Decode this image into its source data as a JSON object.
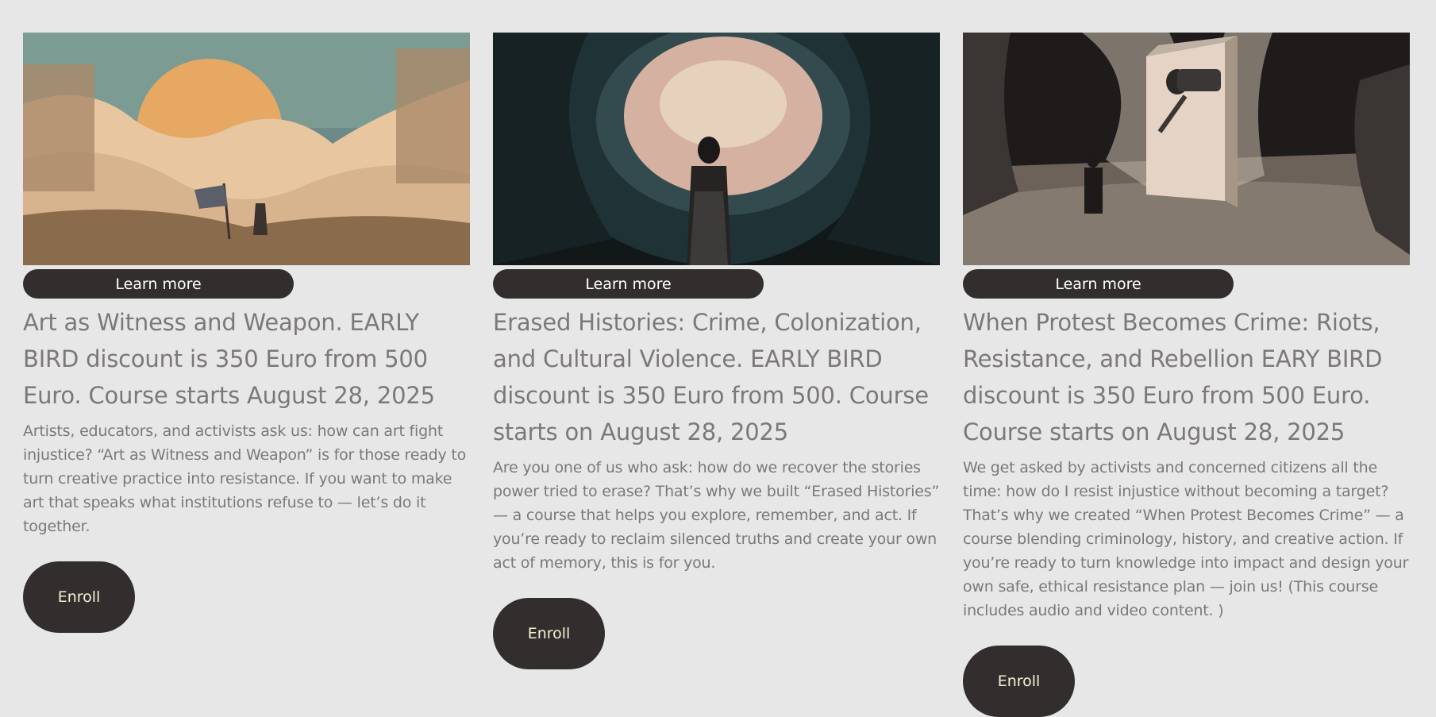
{
  "colors": {
    "background": "#e7e7e7",
    "button": "#332e2e",
    "text": "#7d7878",
    "enroll_text": "#f6f0d4"
  },
  "cards": [
    {
      "learn_more_label": "Learn more",
      "title": "Art as Witness and Weapon. EARLY BIRD discount is 350 Euro from 500 Euro. Course starts August 28, 2025",
      "description": "Artists, educators, and activists ask us: how can art fight injustice? “Art as Witness and Weapon” is for those ready to turn creative practice into resistance. If you want to make art that speaks what institutions refuse to — let’s do it together.",
      "enroll_label": "Enroll"
    },
    {
      "learn_more_label": "Learn more",
      "title": "Erased Histories: Crime, Colonization, and Cultural Violence. EARLY BIRD discount is 350 Euro from 500. Course starts on August 28, 2025",
      "description": "Are you one of us who ask: how do we recover the stories power tried to erase? That’s why we built “Erased Histories” — a course that helps you explore, remember, and act. If you’re ready to reclaim silenced truths and create your own act of memory, this is for you.",
      "enroll_label": "Enroll"
    },
    {
      "learn_more_label": "Learn more",
      "title": "When Protest Becomes Crime: Riots, Resistance, and Rebellion EARY BIRD discount is 350 Euro from 500 Euro. Course starts on August 28, 2025",
      "description": "We get asked by activists and concerned citizens all the time: how do I resist injustice without becoming a target? That’s why we created “When Protest Becomes Crime” — a course blending criminology, history, and creative action. If you’re ready to turn knowledge into impact and design your own safe, ethical resistance plan — join us! (This course includes audio and video content. )",
      "enroll_label": "Enroll"
    }
  ]
}
